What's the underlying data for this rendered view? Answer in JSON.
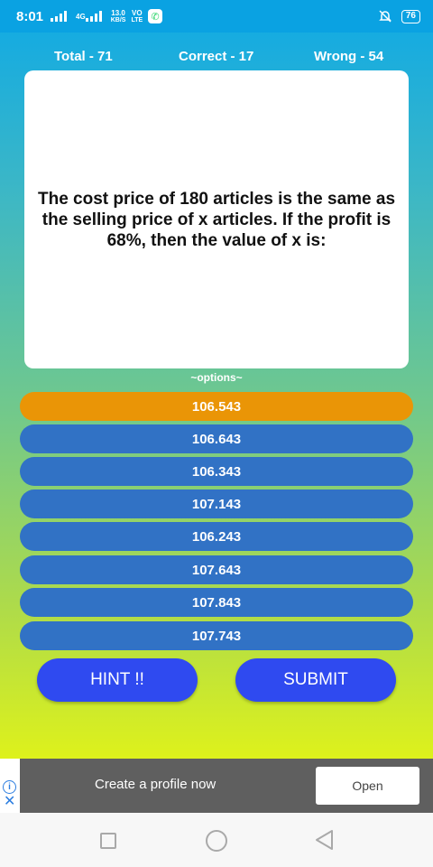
{
  "status_bar": {
    "time": "8:01",
    "network_type": "4G",
    "speed_value": "13.0",
    "speed_unit": "KB/S",
    "volte_top": "VO",
    "volte_bottom": "LTE",
    "battery": "76",
    "icons": [
      "signal-icon",
      "whatsapp-icon",
      "mute-icon",
      "battery-icon"
    ]
  },
  "scores": {
    "total": "Total - 71",
    "correct": "Correct - 17",
    "wrong": "Wrong - 54"
  },
  "question": "The cost price of 180 articles is the same as the selling price of x articles. If the profit is 68%, then the value of x is:",
  "options_label": "~options~",
  "options": [
    "106.543",
    "106.643",
    "106.343",
    "107.143",
    "106.243",
    "107.643",
    "107.843",
    "107.743"
  ],
  "selected_option_index": 0,
  "buttons": {
    "hint": "HINT !!",
    "submit": "SUBMIT"
  },
  "ad": {
    "text": "Create a profile now",
    "cta": "Open"
  },
  "colors": {
    "option_default": "#3172c5",
    "option_selected": "#ea9506",
    "button": "#2f4af0"
  }
}
